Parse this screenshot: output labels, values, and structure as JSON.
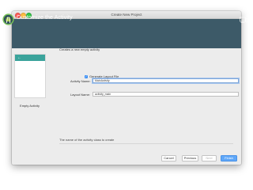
{
  "window": {
    "title": "Create New Project"
  },
  "banner": {
    "title": "Customize the Activity",
    "logo_icon": "android-studio-logo",
    "device_icon": "device-form-factor-icon"
  },
  "preview": {
    "caption": "Empty Activity"
  },
  "form": {
    "subtitle": "Creates a new empty activity",
    "activity_name_label": "Activity Name:",
    "activity_name_value": "MainActivity",
    "generate_layout_label": "Generate Layout File",
    "generate_layout_checked": true,
    "layout_name_label": "Layout Name:",
    "layout_name_value": "activity_main"
  },
  "hint": "The name of the activity class to create",
  "buttons": {
    "cancel": "Cancel",
    "previous": "Previous",
    "next": "Next",
    "finish": "Finish"
  },
  "colors": {
    "banner": "#3d5a68",
    "preview_bar": "#3aa39b",
    "primary_button": "#5fa7f8"
  }
}
